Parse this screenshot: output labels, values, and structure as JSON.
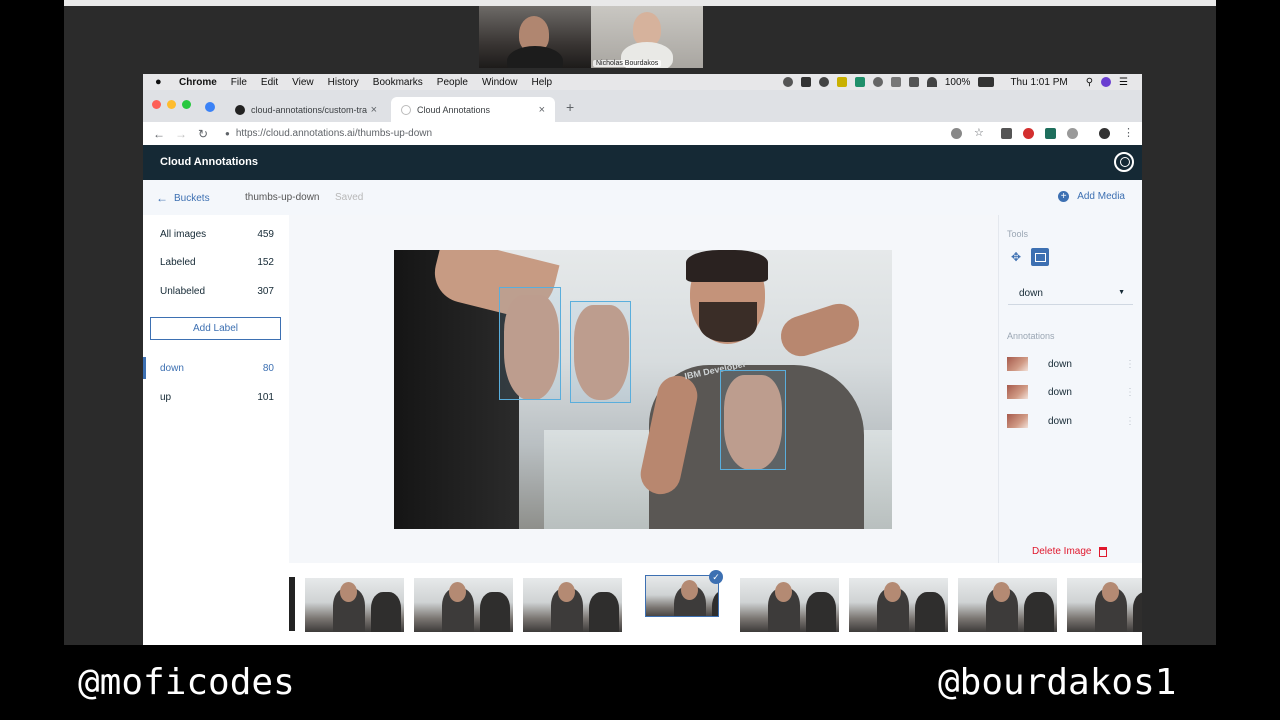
{
  "call": {
    "participant_name": "Nicholas Bourdakos"
  },
  "macos_menu": {
    "app": "Chrome",
    "items": [
      "File",
      "Edit",
      "View",
      "History",
      "Bookmarks",
      "People",
      "Window",
      "Help"
    ],
    "battery": "100%",
    "clock": "Thu 1:01 PM"
  },
  "browser": {
    "tabs": [
      {
        "title": "cloud-annotations/custom-tra",
        "active": false
      },
      {
        "title": "Cloud Annotations",
        "active": true
      }
    ],
    "url": "https://cloud.annotations.ai/thumbs-up-down"
  },
  "app": {
    "title": "Cloud Annotations",
    "subbar": {
      "back_label": "Buckets",
      "bucket_name": "thumbs-up-down",
      "status": "Saved",
      "add_media": "Add Media"
    },
    "filters": [
      {
        "label": "All images",
        "count": "459"
      },
      {
        "label": "Labeled",
        "count": "152"
      },
      {
        "label": "Unlabeled",
        "count": "307"
      }
    ],
    "add_label": "Add Label",
    "labels": [
      {
        "label": "down",
        "count": "80",
        "selected": true
      },
      {
        "label": "up",
        "count": "101",
        "selected": false
      }
    ],
    "image": {
      "shirt_text": "IBM Developer"
    },
    "tools": {
      "heading": "Tools",
      "selected_label": "down"
    },
    "annotations": {
      "heading": "Annotations",
      "items": [
        "down",
        "down",
        "down"
      ]
    },
    "delete_image": "Delete Image"
  },
  "overlay": {
    "left_handle": "@moficodes",
    "right_handle": "@bourdakos1"
  },
  "colors": {
    "header_bg": "#152935",
    "accent": "#3d70b2",
    "bbox": "#5aaedc",
    "danger": "#e0182d"
  }
}
